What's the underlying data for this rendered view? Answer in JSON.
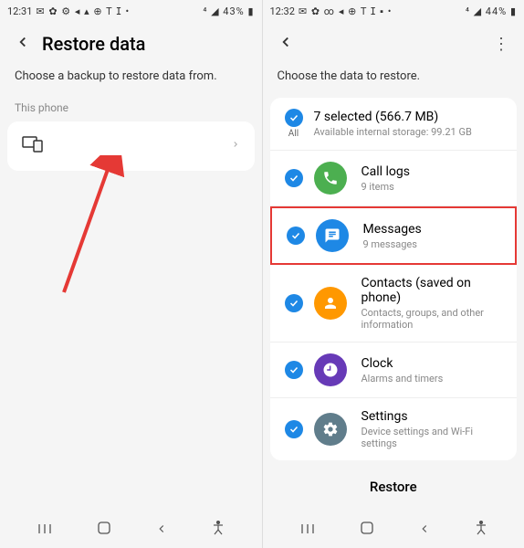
{
  "left": {
    "status": {
      "time": "12:31",
      "icons_left": "✉ ✿ ⚙ ◂ ▴ ⊕ T ⵊ •",
      "icons_right": "⁴ ◢ 43% ▮"
    },
    "header": {
      "title": "Restore data"
    },
    "subtitle": "Choose a backup to restore data from.",
    "section_label": "This phone"
  },
  "right": {
    "status": {
      "time": "12:32",
      "icons_left": "✉ ✿ ∞ ◂ ⊕ T ⵊ ▪ •",
      "icons_right": "⁴ ◢ 44% ▮"
    },
    "header": {
      "title": " "
    },
    "subtitle": "Choose the data to restore.",
    "all": {
      "label": "All",
      "title": "7 selected (566.7 MB)",
      "sub": "Available internal storage: 99.21 GB"
    },
    "items": [
      {
        "title": "Call logs",
        "sub": "9 items",
        "color": "#4caf50"
      },
      {
        "title": "Messages",
        "sub": "9 messages",
        "color": "#1e88e5"
      },
      {
        "title": "Contacts (saved on phone)",
        "sub": "Contacts, groups, and other information",
        "color": "#ff9800"
      },
      {
        "title": "Clock",
        "sub": "Alarms and timers",
        "color": "#673ab7"
      },
      {
        "title": "Settings",
        "sub": "Device settings and Wi-Fi settings",
        "color": "#607d8b"
      }
    ],
    "restore": "Restore"
  }
}
